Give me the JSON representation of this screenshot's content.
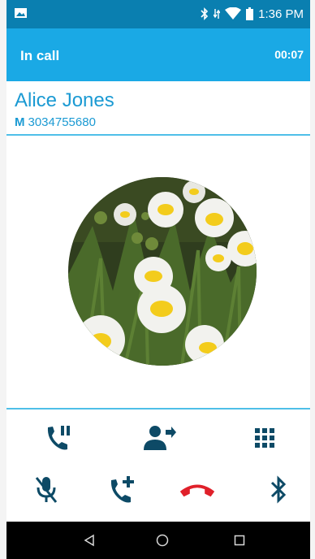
{
  "status_bar": {
    "time": "1:36 PM",
    "icons": [
      "gallery-icon",
      "bluetooth-icon",
      "data-arrows-icon",
      "wifi-icon",
      "battery-icon"
    ]
  },
  "call_header": {
    "title": "In call",
    "duration": "00:07"
  },
  "contact": {
    "name": "Alice Jones",
    "phone_type": "M",
    "phone_number": "3034755680"
  },
  "controls": {
    "row1": [
      "hold-call-icon",
      "transfer-call-icon",
      "dialpad-icon"
    ],
    "row2": [
      "mute-microphone-icon",
      "add-call-icon",
      "end-call-icon",
      "bluetooth-audio-icon"
    ]
  },
  "nav_bar": [
    "back-icon",
    "home-icon",
    "recents-icon"
  ],
  "colors": {
    "status_bar": "#0a7fb0",
    "call_header": "#1aa9e5",
    "accent_text": "#1b9ad3",
    "control_icon": "#0d4a66",
    "end_call": "#e0202a"
  }
}
